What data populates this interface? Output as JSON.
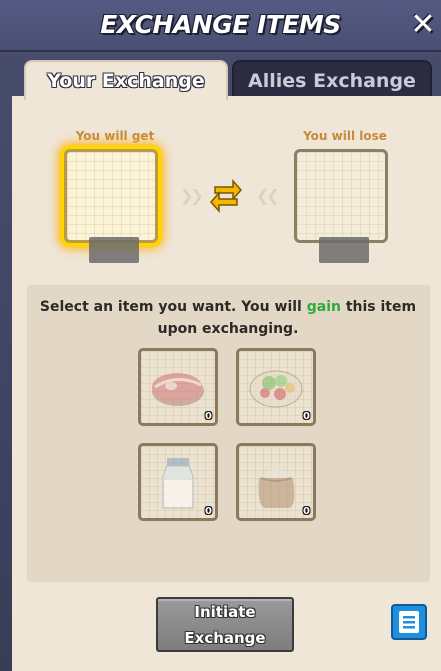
{
  "header": {
    "title": "EXCHANGE ITEMS",
    "close_icon": "close-icon"
  },
  "tabs": [
    {
      "label": "Your Exchange",
      "active": true
    },
    {
      "label": "Allies Exchange",
      "active": false
    }
  ],
  "exchange": {
    "get_label": "You will get",
    "lose_label": "You will lose",
    "swap_icon": "swap-arrows-icon"
  },
  "instruction": {
    "before": "Select an item you want. You will ",
    "highlight": "gain",
    "after": " this item upon exchanging."
  },
  "items": [
    {
      "name": "meat",
      "icon": "meat-icon",
      "quantity": "0"
    },
    {
      "name": "vegetables",
      "icon": "vegetable-bowl-icon",
      "quantity": "0"
    },
    {
      "name": "milk",
      "icon": "milk-bottle-icon",
      "quantity": "0"
    },
    {
      "name": "flour",
      "icon": "flour-sack-icon",
      "quantity": "0"
    }
  ],
  "actions": {
    "initiate_line1": "Initiate",
    "initiate_line2": "Exchange",
    "log_icon": "scroll-log-icon"
  },
  "colors": {
    "gain": "#2eab3b",
    "label_orange": "#c58a3a",
    "highlight_glow": "#ffd400",
    "log_button": "#1f8fe0"
  }
}
